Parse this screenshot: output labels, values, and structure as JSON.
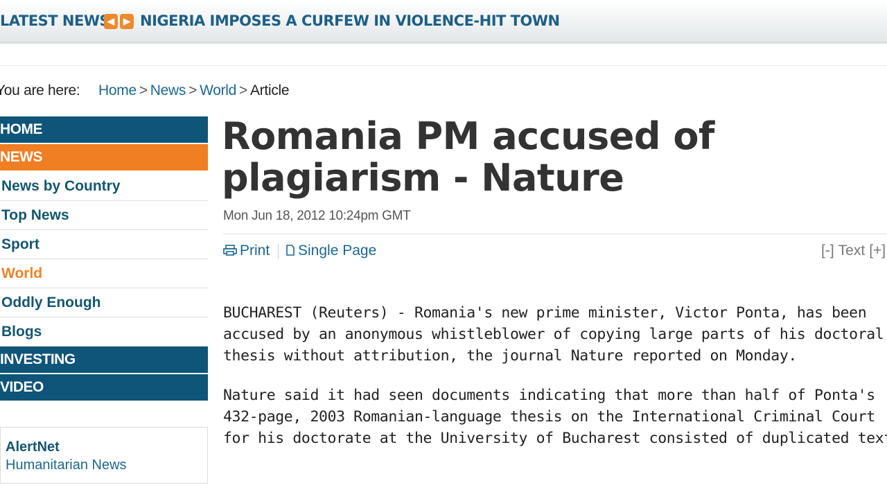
{
  "ticker": {
    "label": "LATEST NEWS",
    "prev_icon": "arrow-left-icon",
    "next_icon": "arrow-right-icon",
    "prev_glyph": "◀",
    "next_glyph": "▶",
    "headline": "NIGERIA IMPOSES A CURFEW IN VIOLENCE-HIT TOWN"
  },
  "breadcrumb": {
    "prefix": "You are here:",
    "items": [
      "Home",
      "News",
      "World"
    ],
    "separator": ">",
    "current": "Article"
  },
  "nav": {
    "items": [
      {
        "label": "HOME",
        "type": "section"
      },
      {
        "label": "NEWS",
        "type": "section",
        "active": true
      },
      {
        "label": "News by Country",
        "type": "sub"
      },
      {
        "label": "Top News",
        "type": "sub"
      },
      {
        "label": "Sport",
        "type": "sub"
      },
      {
        "label": "World",
        "type": "sub",
        "current": true
      },
      {
        "label": "Oddly Enough",
        "type": "sub"
      },
      {
        "label": "Blogs",
        "type": "sub"
      },
      {
        "label": "INVESTING",
        "type": "section"
      },
      {
        "label": "VIDEO",
        "type": "section"
      }
    ]
  },
  "promo": {
    "title": "AlertNet",
    "subtitle": "Humanitarian News"
  },
  "article": {
    "headline": "Romania PM accused of plagiarism - Nature",
    "dateline": "Mon Jun 18, 2012 10:24pm GMT",
    "tools": {
      "print_label": "Print",
      "print_icon": "printer-icon",
      "single_page_label": "Single Page",
      "single_page_icon": "page-icon",
      "text_decrease": "[-]",
      "text_label": "Text",
      "text_increase": "[+]"
    },
    "paragraphs": [
      "BUCHAREST (Reuters) - Romania's new prime minister, Victor Ponta, has been accused by an anonymous whistleblower of copying large parts of his doctoral thesis without attribution, the journal Nature reported on Monday.",
      "Nature said it had seen documents indicating that more than half of Ponta's 432-page, 2003 Romanian-language thesis on the International Criminal Court for his doctorate at the University of Bucharest consisted of duplicated text."
    ]
  },
  "colors": {
    "brand_blue": "#0f5479",
    "accent_orange": "#f07e22",
    "link_blue": "#1d6690",
    "headline_gray": "#333333"
  }
}
